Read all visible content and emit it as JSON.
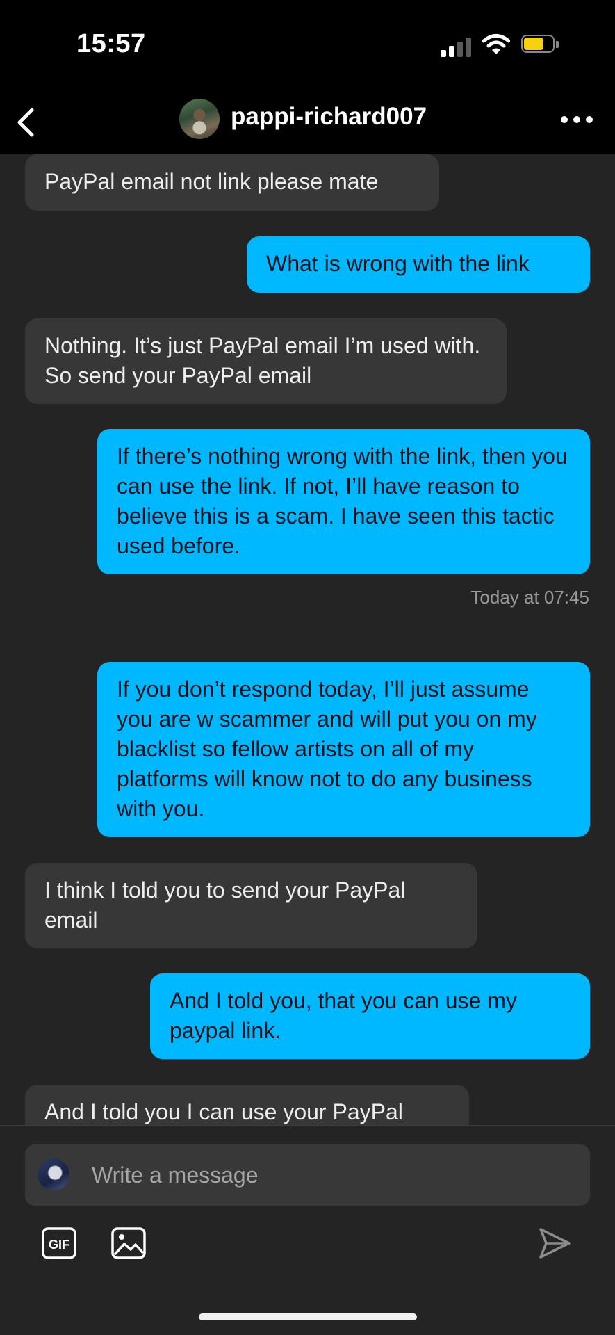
{
  "status": {
    "time": "15:57",
    "battery_color": "#f5d20c",
    "signal_bars_active": 2,
    "signal_bars_total": 4
  },
  "header": {
    "username": "pappi-richard007",
    "back_icon": "chevron-left-icon",
    "more_icon": "ellipsis-icon"
  },
  "colors": {
    "incoming_bubble": "#373737",
    "outgoing_bubble": "#00b8ff",
    "background": "#242424"
  },
  "messages": [
    {
      "direction": "in",
      "text": "PayPal email not link please mate"
    },
    {
      "direction": "out",
      "text": "What is wrong with the link"
    },
    {
      "direction": "in",
      "text": "Nothing. It’s just PayPal email I’m used with. So send your PayPal email"
    },
    {
      "direction": "out",
      "text": "If there’s nothing wrong with the link, then you can use the link. If not, I’ll have reason to believe this is a scam. I have seen this tactic used before."
    },
    {
      "direction": "out",
      "text": "If you don’t respond today, I’ll just assume you are w scammer and will put you on my blacklist so fellow artists on all of my platforms will know not to do any business with you."
    },
    {
      "direction": "in",
      "text": "I think I told you to send your PayPal email"
    },
    {
      "direction": "out",
      "text": "And I told you, that you can use my paypal link."
    },
    {
      "direction": "in",
      "text": "And I told you I can use your PayPal"
    }
  ],
  "timestamp": "Today at 07:45",
  "composer": {
    "placeholder": "Write a message",
    "gif_label": "GIF"
  }
}
